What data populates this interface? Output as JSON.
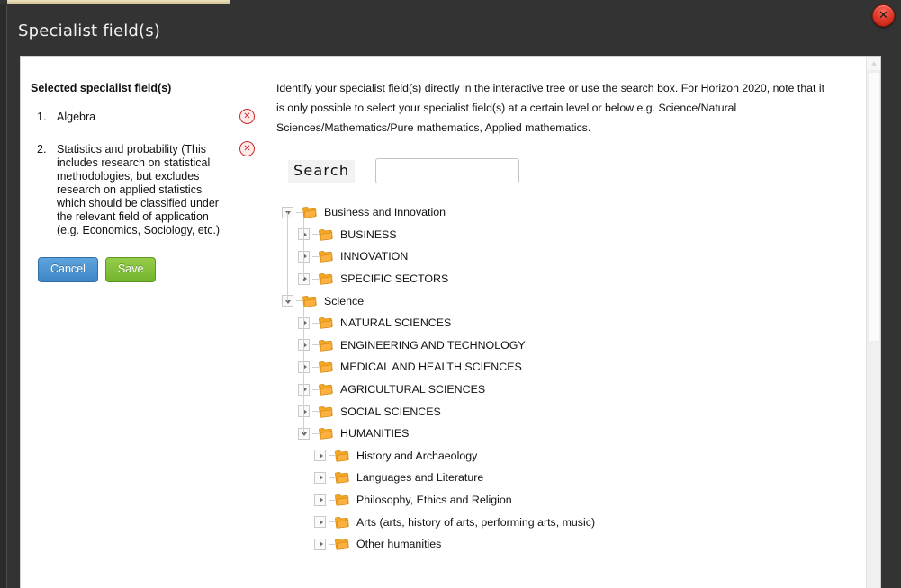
{
  "window": {
    "title": "Specialist field(s)",
    "close_label": "Close",
    "close_icon": "close-circle-icon"
  },
  "left_panel": {
    "heading": "Selected specialist field(s)",
    "items": [
      {
        "number": "1.",
        "label": "Algebra",
        "remove_icon": "remove-circle-icon"
      },
      {
        "number": "2.",
        "label": "Statistics and probability (This includes research on statistical methodologies, but excludes research on applied statistics which should be classified under the relevant field of application (e.g. Economics, Sociology, etc.)",
        "remove_icon": "remove-circle-icon"
      }
    ],
    "buttons": {
      "cancel": "Cancel",
      "save": "Save"
    },
    "colors": {
      "cancel": "#3d86c6",
      "save": "#74b52d",
      "remove": "#cc2b2b"
    }
  },
  "right_panel": {
    "intro": "Identify your specialist field(s) directly in the interactive tree or use the search box. For Horizon 2020, note that it is only possible to select your specialist field(s) at a certain level or below e.g. Science/Natural Sciences/Mathematics/Pure mathematics, Applied mathematics.",
    "search": {
      "label": "Search",
      "value": "",
      "placeholder": ""
    },
    "tree": {
      "folder_icon": "folder-icon",
      "expand_icon": "chevron-right-icon",
      "collapse_icon": "chevron-down-icon",
      "folder_color": "#f5a623",
      "nodes": [
        {
          "label": "Business and Innovation",
          "level": 0,
          "state": "expanded"
        },
        {
          "label": "BUSINESS",
          "level": 1,
          "state": "collapsed"
        },
        {
          "label": "INNOVATION",
          "level": 1,
          "state": "collapsed"
        },
        {
          "label": "SPECIFIC SECTORS",
          "level": 1,
          "state": "collapsed"
        },
        {
          "label": "Science",
          "level": 0,
          "state": "expanded"
        },
        {
          "label": "NATURAL SCIENCES",
          "level": 1,
          "state": "collapsed"
        },
        {
          "label": "ENGINEERING AND TECHNOLOGY",
          "level": 1,
          "state": "collapsed"
        },
        {
          "label": "MEDICAL AND HEALTH SCIENCES",
          "level": 1,
          "state": "collapsed"
        },
        {
          "label": "AGRICULTURAL SCIENCES",
          "level": 1,
          "state": "collapsed"
        },
        {
          "label": "SOCIAL SCIENCES",
          "level": 1,
          "state": "collapsed"
        },
        {
          "label": "HUMANITIES",
          "level": 1,
          "state": "expanded"
        },
        {
          "label": "History and Archaeology",
          "level": 2,
          "state": "collapsed"
        },
        {
          "label": "Languages and Literature",
          "level": 2,
          "state": "collapsed"
        },
        {
          "label": "Philosophy, Ethics and Religion",
          "level": 2,
          "state": "collapsed"
        },
        {
          "label": "Arts (arts, history of arts, performing arts, music)",
          "level": 2,
          "state": "collapsed"
        },
        {
          "label": "Other humanities",
          "level": 2,
          "state": "collapsed"
        }
      ]
    }
  },
  "scrollbar": {
    "up_icon": "chevron-up-icon"
  }
}
